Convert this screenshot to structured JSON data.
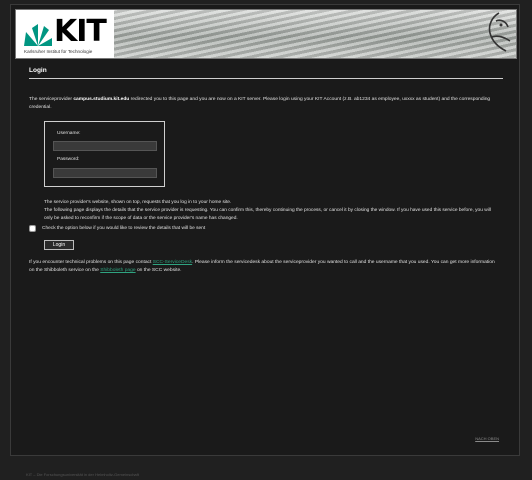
{
  "brand": {
    "logo_text": "KIT",
    "logo_subtitle": "Karlsruher Institut für Technologie"
  },
  "page": {
    "heading": "Login",
    "intro_prefix": "The serviceprovider ",
    "intro_service": "campus.studium.kit.edu",
    "intro_suffix": " redirected you to this page and you are now on a KIT server. Please login using your KIT Account (z.B. ab1234 as employee, uxxxx as student) and the corresponding credential."
  },
  "form": {
    "username_label": "Username:",
    "username_value": "",
    "password_label": "Password:",
    "password_value": ""
  },
  "info": {
    "line1": "The service provider's website, shown on top, requests that you log in to your home site.",
    "line2": "The following page displays the details that the service provider is requesting. You can confirm this, thereby continuing the process, or cancel it by closing the window. If you have used this service before, you will only be asked to reconfirm if the scope of data or the service provider's name has changed."
  },
  "consent": {
    "label": "Check the option below if you would like to review the details that will be sent"
  },
  "buttons": {
    "login": "Login"
  },
  "help": {
    "prefix": "If you encounter technical problems on this page contact ",
    "link1": "SCC-ServiceDesk",
    "middle": ". Please inform the servicedesk about the serviceprovider you wanted to call and the username that you used. You can get more information on the Shibboleth service on the ",
    "link2": "Shibboleth page",
    "suffix": " on the SCC website."
  },
  "footer": {
    "right": "NACH OBEN",
    "left": "KIT – Die Forschungsuniversität in der Helmholtz-Gemeinschaft"
  }
}
